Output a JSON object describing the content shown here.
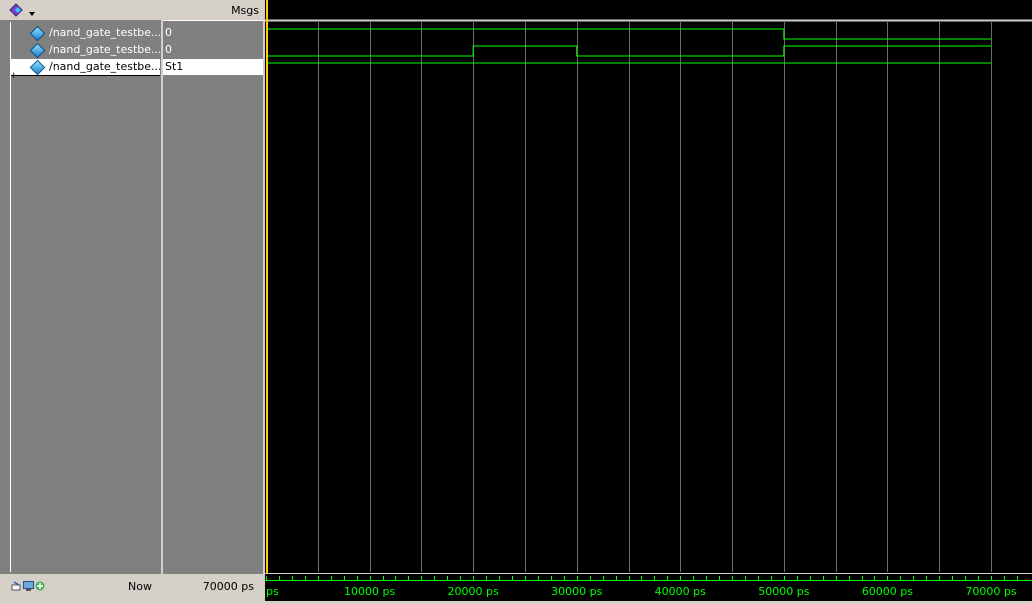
{
  "header": {
    "msgs_label": "Msgs"
  },
  "signals": [
    {
      "name": "/nand_gate_testbe...",
      "value": "0"
    },
    {
      "name": "/nand_gate_testbe...",
      "value": "0"
    },
    {
      "name": "/nand_gate_testbe...",
      "value": "St1"
    }
  ],
  "footer": {
    "now_label": "Now",
    "now_value": "70000 ps"
  },
  "timeline": {
    "unit": "ps",
    "start_label": "ps",
    "tick_labels": [
      "10000 ps",
      "20000 ps",
      "30000 ps",
      "40000 ps",
      "50000 ps",
      "60000 ps",
      "70000 ps"
    ]
  },
  "colors": {
    "wave": "#00ff00",
    "grid": "#6a6a6a",
    "cursor": "#ffcc00",
    "background": "#000000"
  },
  "waveforms": [
    {
      "transitions": [
        [
          0,
          1
        ],
        [
          30000,
          1
        ],
        [
          50000,
          0
        ],
        [
          70000,
          0
        ]
      ]
    },
    {
      "transitions": [
        [
          0,
          0
        ],
        [
          20000,
          1
        ],
        [
          30000,
          0
        ],
        [
          50000,
          1
        ],
        [
          70000,
          1
        ]
      ]
    },
    {
      "transitions": [
        [
          0,
          1
        ],
        [
          70000,
          1
        ]
      ]
    }
  ]
}
